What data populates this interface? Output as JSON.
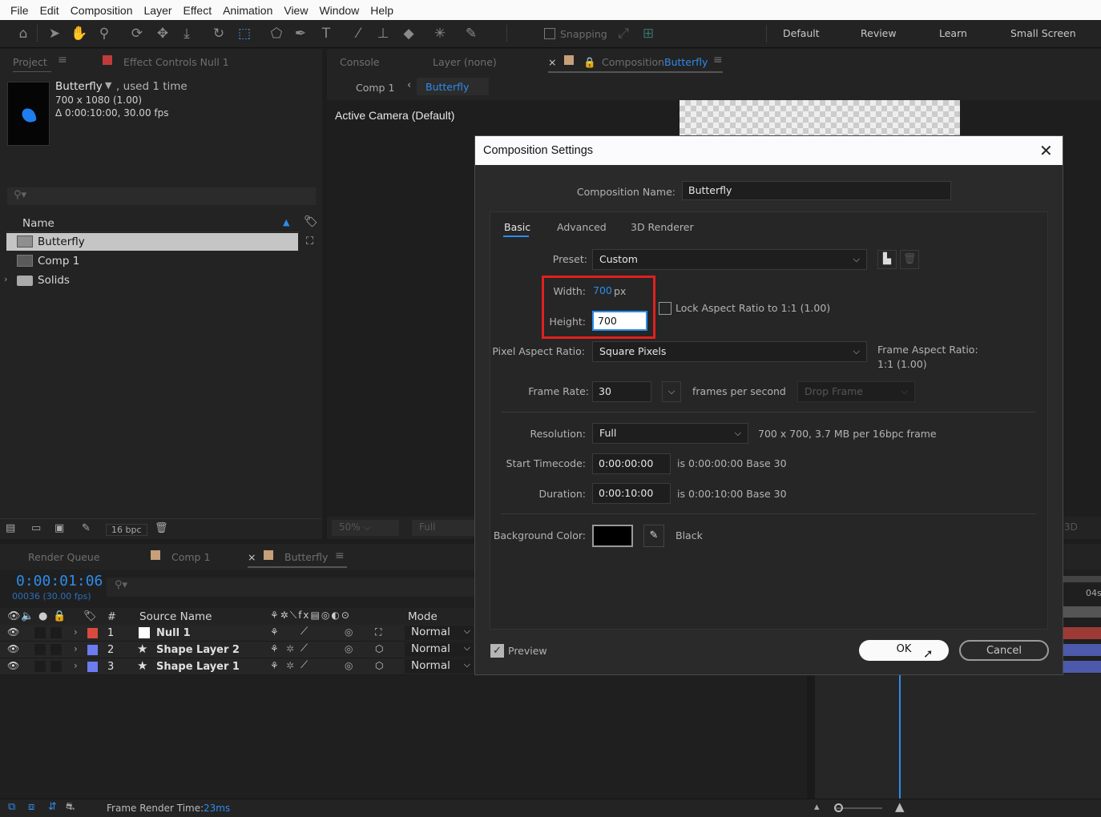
{
  "menubar": {
    "items": [
      "File",
      "Edit",
      "Composition",
      "Layer",
      "Effect",
      "Animation",
      "View",
      "Window",
      "Help"
    ]
  },
  "toolbar": {
    "snapping_label": "Snapping",
    "workspaces": [
      "Default",
      "Review",
      "Learn",
      "Small Screen"
    ]
  },
  "project_panel": {
    "tab_project": "Project",
    "tab_effect_controls": "Effect Controls Null 1",
    "item_name": "Butterfly",
    "item_used": ", used 1 time",
    "item_size": "700 x 1080 (1.00)",
    "item_duration": "Δ 0:00:10:00, 30.00 fps",
    "column_name": "Name",
    "items": [
      {
        "label": "Butterfly",
        "type": "comp"
      },
      {
        "label": "Comp 1",
        "type": "comp"
      },
      {
        "label": "Solids",
        "type": "folder"
      }
    ],
    "bpc": "16 bpc"
  },
  "viewer": {
    "tab_console": "Console",
    "tab_layer": "Layer (none)",
    "tab_composition_prefix": "Composition",
    "tab_composition_name": "Butterfly",
    "breadcrumb_comp1": "Comp 1",
    "breadcrumb_current": "Butterfly",
    "camera_label": "Active Camera (Default)",
    "zoom": "50%",
    "resolution": "Full",
    "right_label": "3D"
  },
  "timeline": {
    "tab_render_queue": "Render Queue",
    "tab_comp1": "Comp 1",
    "tab_butterfly": "Butterfly",
    "timecode": "0:00:01:06",
    "frame_info": "00036 (30.00 fps)",
    "col_num": "#",
    "col_source": "Source Name",
    "col_mode": "Mode",
    "time_marker": "04s",
    "layers": [
      {
        "num": "1",
        "name": "Null 1",
        "mode": "Normal",
        "color": "#d94a3d"
      },
      {
        "num": "2",
        "name": "Shape Layer 2",
        "mode": "Normal",
        "color": "#6b7cf0"
      },
      {
        "num": "3",
        "name": "Shape Layer 1",
        "mode": "Normal",
        "color": "#6b7cf0"
      }
    ],
    "render_time_label": "Frame Render Time:",
    "render_time_value": "23ms"
  },
  "dialog": {
    "title": "Composition Settings",
    "comp_name_label": "Composition Name:",
    "comp_name_value": "Butterfly",
    "tabs": [
      "Basic",
      "Advanced",
      "3D Renderer"
    ],
    "preset_label": "Preset:",
    "preset_value": "Custom",
    "width_label": "Width:",
    "width_value": "700",
    "width_unit": "px",
    "height_label": "Height:",
    "height_value": "700",
    "lock_aspect_label": "Lock Aspect Ratio to 1:1 (1.00)",
    "par_label": "Pixel Aspect Ratio:",
    "par_value": "Square Pixels",
    "frame_aspect_label": "Frame Aspect Ratio:",
    "frame_aspect_value": "1:1 (1.00)",
    "frame_rate_label": "Frame Rate:",
    "frame_rate_value": "30",
    "fps_label": "frames per second",
    "drop_frame": "Drop Frame",
    "resolution_label": "Resolution:",
    "resolution_value": "Full",
    "resolution_info": "700 x 700, 3.7 MB per 16bpc frame",
    "start_tc_label": "Start Timecode:",
    "start_tc_value": "0:00:00:00",
    "start_tc_info": "is 0:00:00:00  Base 30",
    "duration_label": "Duration:",
    "duration_value": "0:00:10:00",
    "duration_info": "is 0:00:10:00  Base 30",
    "bg_label": "Background Color:",
    "bg_name": "Black",
    "bg_color": "#000000",
    "preview_label": "Preview",
    "ok_label": "OK",
    "cancel_label": "Cancel"
  },
  "colors": {
    "accent": "#2d8ceb",
    "highlight_box": "#e02020"
  }
}
